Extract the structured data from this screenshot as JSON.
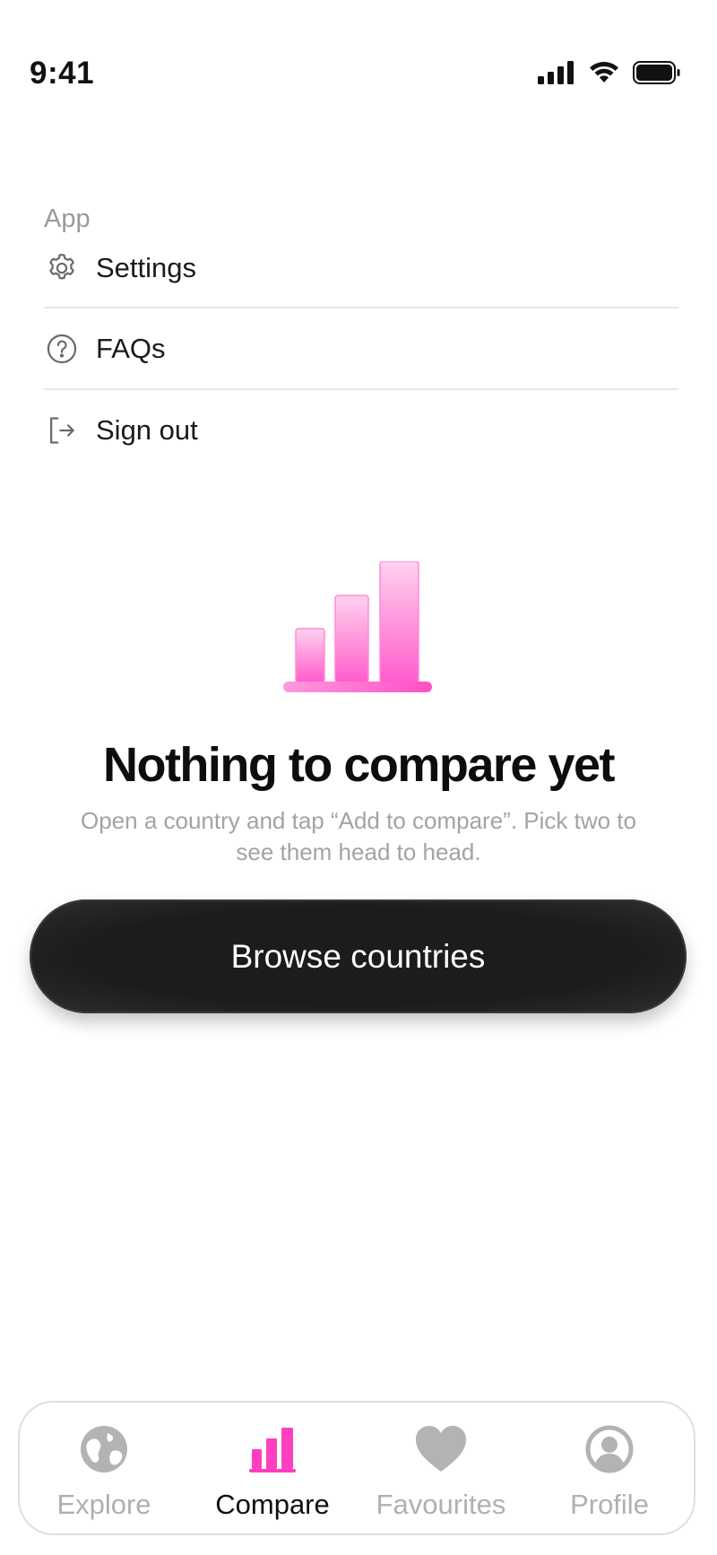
{
  "status_bar": {
    "time": "9:41"
  },
  "menu": {
    "section_label": "App",
    "items": [
      {
        "label": "Settings",
        "icon": "gear-icon"
      },
      {
        "label": "FAQs",
        "icon": "question-circle-icon"
      },
      {
        "label": "Sign out",
        "icon": "sign-out-icon"
      }
    ]
  },
  "empty_state": {
    "icon": "bar-chart-icon",
    "title": "Nothing to compare yet",
    "subtitle": "Open a country and tap “Add to compare”. Pick two to see them head to head.",
    "button_label": "Browse countries"
  },
  "tab_bar": {
    "tabs": [
      {
        "label": "Explore",
        "icon": "globe-icon",
        "active": false
      },
      {
        "label": "Compare",
        "icon": "bar-chart-icon",
        "active": true
      },
      {
        "label": "Favourites",
        "icon": "heart-icon",
        "active": false
      },
      {
        "label": "Profile",
        "icon": "person-circle-icon",
        "active": false
      }
    ]
  },
  "colors": {
    "accent": "#ff3fbf",
    "inactive_tab": "#b0b0b0",
    "button_bg": "#1c1c1c"
  }
}
